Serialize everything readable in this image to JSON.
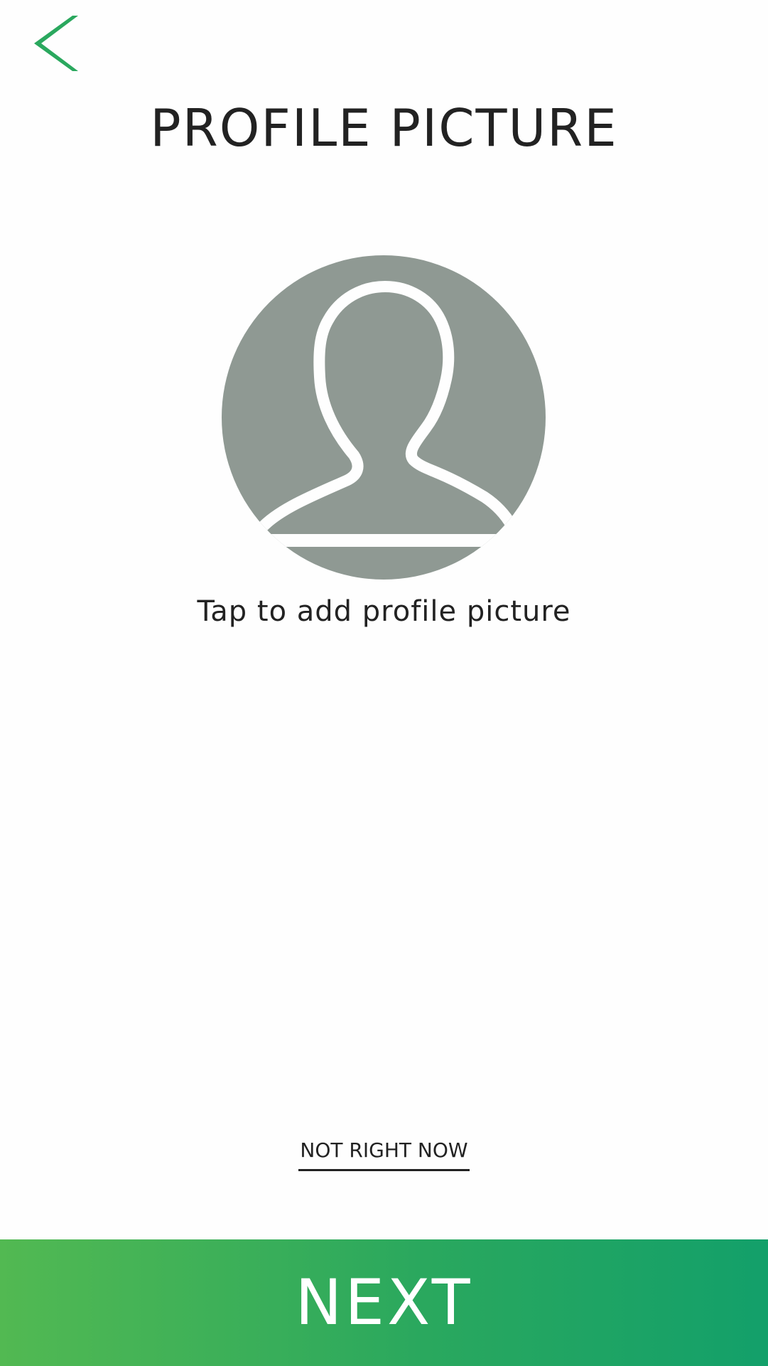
{
  "header": {
    "back_icon": "chevron-left-icon",
    "title": "PROFILE PICTURE"
  },
  "avatar": {
    "icon": "user-silhouette-icon",
    "prompt": "Tap to add profile picture"
  },
  "actions": {
    "skip_label": "NOT RIGHT NOW",
    "next_label": "NEXT"
  },
  "colors": {
    "accent": "#2aa85e",
    "avatar_bg": "#8f9993",
    "text": "#222222"
  }
}
